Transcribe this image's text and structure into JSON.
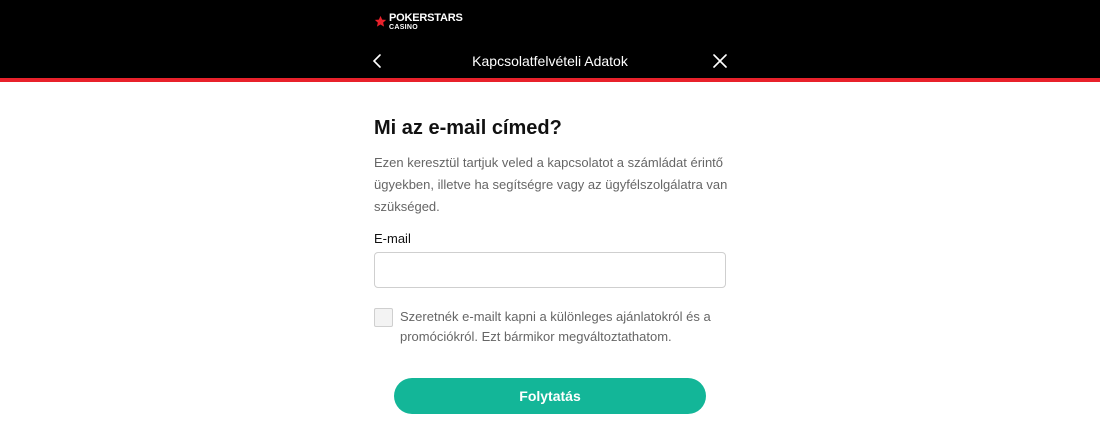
{
  "header": {
    "logo_main": "POKERSTARS",
    "logo_sub": "CASINO",
    "title": "Kapcsolatfelvételi Adatok",
    "back_icon": "chevron-left-icon",
    "close_icon": "close-icon",
    "accent_color": "#e8212b"
  },
  "form": {
    "heading": "Mi az e-mail címed?",
    "description": "Ezen keresztül tartjuk veled a kapcsolatot a számládat érintő ügyekben, illetve ha segítségre vagy az ügyfélszolgálatra van szükséged.",
    "email_label": "E-mail",
    "email_value": "",
    "email_placeholder": "",
    "checkbox_checked": false,
    "checkbox_label": "Szeretnék e-mailt kapni a különleges ajánlatokról és a promóciókról. Ezt bármikor megváltoztathatom.",
    "continue_label": "Folytatás",
    "button_color": "#13b698"
  }
}
